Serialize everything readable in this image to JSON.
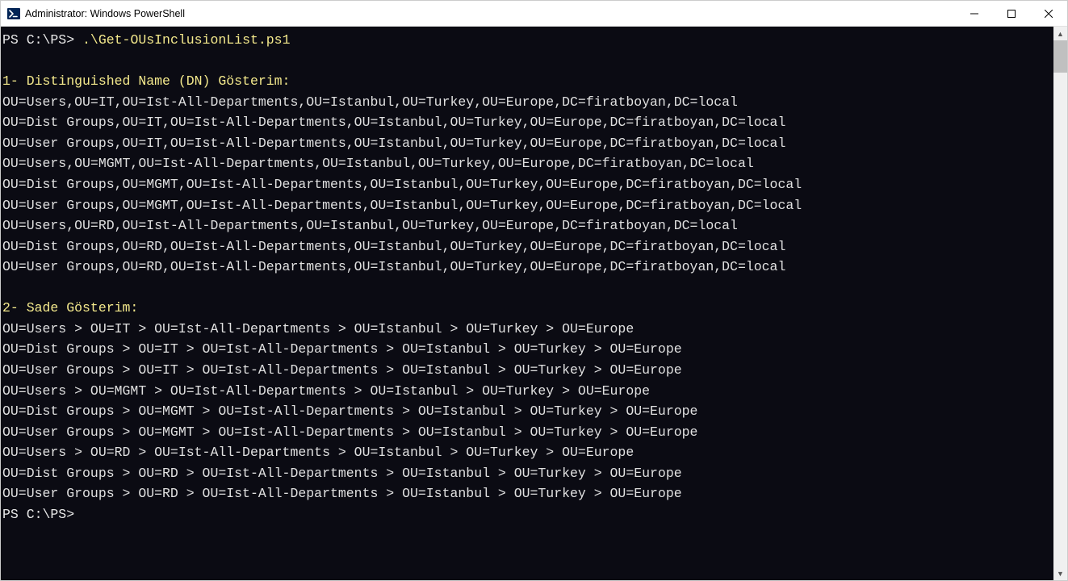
{
  "window": {
    "title": "Administrator: Windows PowerShell"
  },
  "terminal": {
    "prompt1": "PS C:\\PS> ",
    "command": ".\\Get-OUsInclusionList.ps1",
    "heading1": "1- Distinguished Name (DN) Gösterim:",
    "dn_lines": [
      "OU=Users,OU=IT,OU=Ist-All-Departments,OU=Istanbul,OU=Turkey,OU=Europe,DC=firatboyan,DC=local",
      "OU=Dist Groups,OU=IT,OU=Ist-All-Departments,OU=Istanbul,OU=Turkey,OU=Europe,DC=firatboyan,DC=local",
      "OU=User Groups,OU=IT,OU=Ist-All-Departments,OU=Istanbul,OU=Turkey,OU=Europe,DC=firatboyan,DC=local",
      "OU=Users,OU=MGMT,OU=Ist-All-Departments,OU=Istanbul,OU=Turkey,OU=Europe,DC=firatboyan,DC=local",
      "OU=Dist Groups,OU=MGMT,OU=Ist-All-Departments,OU=Istanbul,OU=Turkey,OU=Europe,DC=firatboyan,DC=local",
      "OU=User Groups,OU=MGMT,OU=Ist-All-Departments,OU=Istanbul,OU=Turkey,OU=Europe,DC=firatboyan,DC=local",
      "OU=Users,OU=RD,OU=Ist-All-Departments,OU=Istanbul,OU=Turkey,OU=Europe,DC=firatboyan,DC=local",
      "OU=Dist Groups,OU=RD,OU=Ist-All-Departments,OU=Istanbul,OU=Turkey,OU=Europe,DC=firatboyan,DC=local",
      "OU=User Groups,OU=RD,OU=Ist-All-Departments,OU=Istanbul,OU=Turkey,OU=Europe,DC=firatboyan,DC=local"
    ],
    "heading2": "2- Sade Gösterim:",
    "sade_lines": [
      "OU=Users > OU=IT > OU=Ist-All-Departments > OU=Istanbul > OU=Turkey > OU=Europe",
      "OU=Dist Groups > OU=IT > OU=Ist-All-Departments > OU=Istanbul > OU=Turkey > OU=Europe",
      "OU=User Groups > OU=IT > OU=Ist-All-Departments > OU=Istanbul > OU=Turkey > OU=Europe",
      "OU=Users > OU=MGMT > OU=Ist-All-Departments > OU=Istanbul > OU=Turkey > OU=Europe",
      "OU=Dist Groups > OU=MGMT > OU=Ist-All-Departments > OU=Istanbul > OU=Turkey > OU=Europe",
      "OU=User Groups > OU=MGMT > OU=Ist-All-Departments > OU=Istanbul > OU=Turkey > OU=Europe",
      "OU=Users > OU=RD > OU=Ist-All-Departments > OU=Istanbul > OU=Turkey > OU=Europe",
      "OU=Dist Groups > OU=RD > OU=Ist-All-Departments > OU=Istanbul > OU=Turkey > OU=Europe",
      "OU=User Groups > OU=RD > OU=Ist-All-Departments > OU=Istanbul > OU=Turkey > OU=Europe"
    ],
    "prompt2": "PS C:\\PS>"
  }
}
